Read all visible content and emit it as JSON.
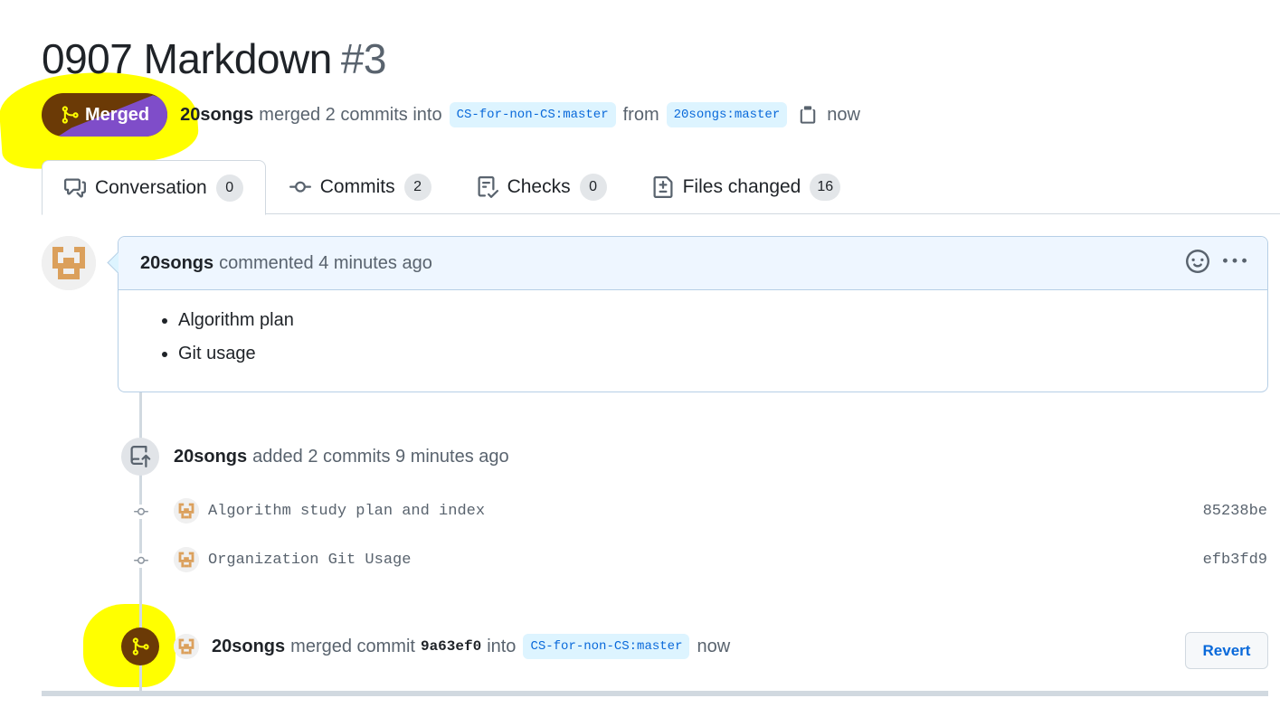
{
  "header": {
    "title": "0907 Markdown",
    "number": "#3"
  },
  "meta": {
    "state": "Merged",
    "author": "20songs",
    "merged_text": "merged 2 commits into",
    "base_branch": "CS-for-non-CS:master",
    "from_text": "from",
    "head_branch": "20songs:master",
    "time": "now"
  },
  "tabs": [
    {
      "label": "Conversation",
      "count": "0"
    },
    {
      "label": "Commits",
      "count": "2"
    },
    {
      "label": "Checks",
      "count": "0"
    },
    {
      "label": "Files changed",
      "count": "16"
    }
  ],
  "comment": {
    "author": "20songs",
    "action": "commented 4 minutes ago",
    "items": [
      "Algorithm plan",
      "Git usage"
    ]
  },
  "commits_event": {
    "author": "20songs",
    "text": "added 2 commits 9 minutes ago"
  },
  "commits": [
    {
      "message": "Algorithm study plan and index",
      "sha": "85238be"
    },
    {
      "message": "Organization Git Usage",
      "sha": "efb3fd9"
    }
  ],
  "merge_event": {
    "author": "20songs",
    "text1": "merged commit",
    "sha": "9a63ef0",
    "text2": "into",
    "branch": "CS-for-non-CS:master",
    "time": "now",
    "revert_label": "Revert"
  },
  "colors": {
    "merged_badge": "#6b3a06",
    "highlight": "#ffff00",
    "link": "#0969da"
  }
}
